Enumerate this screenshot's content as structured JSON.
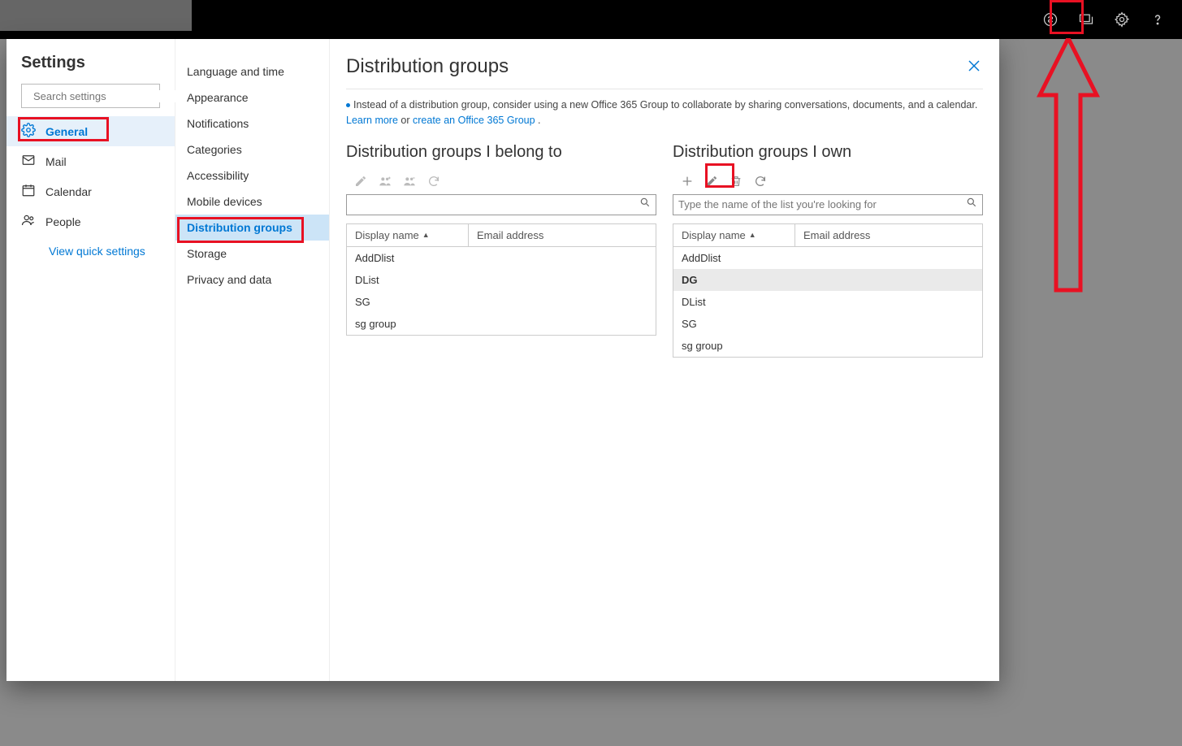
{
  "topbar": {
    "icons": [
      "skype-icon",
      "feedback-icon",
      "gear-icon",
      "help-icon"
    ]
  },
  "settings": {
    "title": "Settings",
    "search_placeholder": "Search settings",
    "nav1": [
      {
        "icon": "gear",
        "label": "General",
        "active": true
      },
      {
        "icon": "mail",
        "label": "Mail"
      },
      {
        "icon": "calendar",
        "label": "Calendar"
      },
      {
        "icon": "people",
        "label": "People"
      }
    ],
    "quick_link": "View quick settings",
    "nav2": [
      {
        "label": "Language and time"
      },
      {
        "label": "Appearance"
      },
      {
        "label": "Notifications"
      },
      {
        "label": "Categories"
      },
      {
        "label": "Accessibility"
      },
      {
        "label": "Mobile devices"
      },
      {
        "label": "Distribution groups",
        "active": true
      },
      {
        "label": "Storage"
      },
      {
        "label": "Privacy and data"
      }
    ]
  },
  "main": {
    "title": "Distribution groups",
    "tip_prefix": "Instead of a distribution group, consider using a new Office 365 Group to collaborate by sharing conversations, documents, and a calendar. ",
    "tip_link1": "Learn more",
    "tip_or": " or ",
    "tip_link2": "create an Office 365 Group",
    "tip_period": " .",
    "belong": {
      "title": "Distribution groups I belong to",
      "search_placeholder": "",
      "col1": "Display name",
      "col2": "Email address",
      "rows": [
        "AddDlist",
        "DList",
        "SG",
        "sg group"
      ],
      "selected": -1
    },
    "own": {
      "title": "Distribution groups I own",
      "search_placeholder": "Type the name of the list you're looking for",
      "col1": "Display name",
      "col2": "Email address",
      "rows": [
        "AddDlist",
        "DG",
        "DList",
        "SG",
        "sg group"
      ],
      "selected": 1
    }
  }
}
